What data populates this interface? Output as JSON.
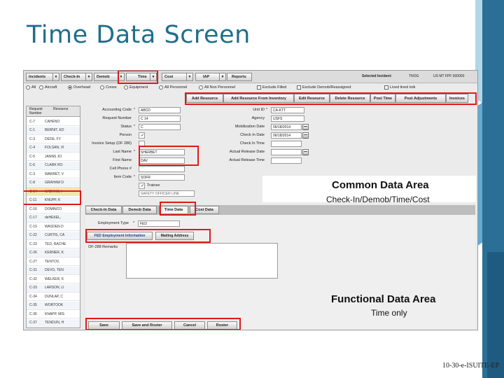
{
  "slide": {
    "title": "Time Data Screen",
    "footer": "10-30-e-ISUITE-EP"
  },
  "colors": {
    "highlight": "#e11a1a",
    "title": "#1f6f8b",
    "accent": "#2b6f97"
  },
  "app": {
    "menu": [
      "Incidents",
      "Check-In",
      "Demob",
      "Time",
      "Cost",
      "IAP",
      "Reports"
    ],
    "selected_incident_label": "Selected Incident:",
    "selected_incident_value": "TNOG",
    "selected_incident_id": "US MT FPF 000000",
    "filters": [
      "All",
      "Aircraft",
      "Overhead",
      "Crews",
      "Equipment",
      "All Personnel",
      "All Non Personnel"
    ],
    "checks": [
      "Exclude Filled",
      "Exclude Demob/Reassigned",
      "Lived lined tolk"
    ],
    "actions": [
      "Add Resource",
      "Add Resource From Inventory",
      "Edit Resource",
      "Delete Resource",
      "Post Time",
      "Post Adjustments",
      "Invoices"
    ],
    "list_headers": [
      "Request Number",
      "Resource"
    ],
    "list_rows": [
      {
        "req": "C-7",
        "name": "CAHENO"
      },
      {
        "req": "C-1",
        "name": "BERNIT, ED"
      },
      {
        "req": "C-3",
        "name": "DEDE, FY"
      },
      {
        "req": "C-4",
        "name": "FOLSAN, VI"
      },
      {
        "req": "C-5",
        "name": "JANNS JO"
      },
      {
        "req": "C-6",
        "name": "CLARK RO"
      },
      {
        "req": "C-3",
        "name": "WARRET, V"
      },
      {
        "req": "C-8",
        "name": "GRAHAM D"
      },
      {
        "req": "C-14",
        "name": "KAEHHS, I"
      },
      {
        "req": "C-11",
        "name": "KNUPF, K"
      },
      {
        "req": "C-16",
        "name": "DOMINCO"
      },
      {
        "req": "C-17",
        "name": "deHEKEL,"
      },
      {
        "req": "C-19",
        "name": "WASDEN D"
      },
      {
        "req": "C-22",
        "name": "CURTIS, CA"
      },
      {
        "req": "C-23",
        "name": "TED, RACHE"
      },
      {
        "req": "C-26",
        "name": "KERNER, K"
      },
      {
        "req": "C-27",
        "name": "TENTOV,"
      },
      {
        "req": "C-31",
        "name": "DEVO, TEN"
      },
      {
        "req": "C-32",
        "name": "WELKER, K"
      },
      {
        "req": "C-33",
        "name": "LARSON, LI"
      },
      {
        "req": "C-34",
        "name": "DUNLAP, C"
      },
      {
        "req": "C-35",
        "name": "WORTOOK"
      },
      {
        "req": "C-36",
        "name": "KNAPP, MIS"
      },
      {
        "req": "C-37",
        "name": "TENDUN, H"
      }
    ],
    "form": {
      "accounting_code_label": "Accounting Code",
      "accounting_code_value": "ABCD",
      "request_number_label": "Request Number",
      "request_number_value": "C 14",
      "status_label": "Status",
      "status_value": "C",
      "person_label": "Person",
      "invoice_label": "Invoice Setup (OF 286)",
      "last_name_label": "Last Name",
      "last_name_value": "SHERBET",
      "first_name_label": "First Name",
      "first_name_value": "DAV",
      "cell_phone_label": "Cell Phone #",
      "item_code_label": "Item Code",
      "item_code_value": "SOFR",
      "trainee_label": "Trainee",
      "item_desc_value": "SAFETY OFFICER LINE",
      "unit_id_label": "Unit ID",
      "unit_id_value": "CA-KTT",
      "agency_label": "Agency",
      "agency_value": "USFS",
      "mob_date_label": "Mobilization Date",
      "mob_date_value": "06/18/2014",
      "check_in_date_label": "Check In Date",
      "check_in_date_value": "06/18/2014",
      "check_in_time_label": "Check In Time",
      "actual_release_date_label": "Actual Release Date",
      "actual_release_time_label": "Actual Release Time"
    },
    "tabs": [
      "Check-In Data",
      "Demob Data",
      "Time Data",
      "Cost Data"
    ],
    "subtabs": [
      "FED Employment Information",
      "Mailing Address"
    ],
    "employment_type_label": "Employment Type",
    "employment_type_value": "FED",
    "remarks_label": "OF-288 Remarks",
    "bottom_buttons": [
      "Save",
      "Save and Roster",
      "Cancel",
      "Roster"
    ]
  },
  "captions": {
    "common_title": "Common Data Area",
    "common_sub": "Check-In/Demob/Time/Cost",
    "functional_title": "Functional Data Area",
    "functional_sub": "Time only"
  }
}
